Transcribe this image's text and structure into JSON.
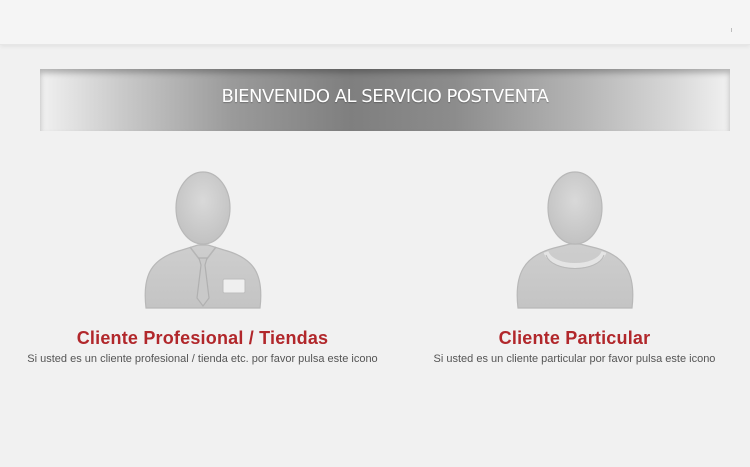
{
  "banner": {
    "title": "BIENVENIDO AL SERVICIO POSTVENTA"
  },
  "options": [
    {
      "title": "Cliente Profesional / Tiendas",
      "description": "Si usted es un cliente profesional / tienda etc. por favor pulsa este icono",
      "icon": "professional-user-icon"
    },
    {
      "title": "Cliente Particular",
      "description": "Si usted es un cliente particular por favor pulsa este icono",
      "icon": "private-user-icon"
    }
  ],
  "colors": {
    "accent": "#b1272b",
    "background": "#f1f1f1",
    "icon": "#cfcfcf"
  }
}
